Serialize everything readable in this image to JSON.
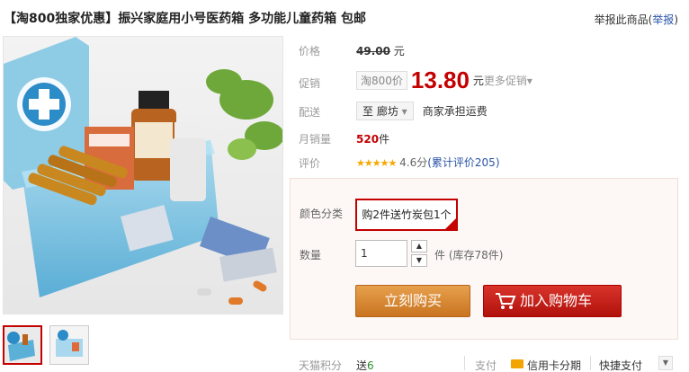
{
  "title": "【淘800独家优惠】振兴家庭用小号医药箱 多功能儿童药箱 包邮",
  "report": {
    "text": "举报此商品",
    "link": "举报"
  },
  "price": {
    "label": "价格",
    "value": "49.00",
    "unit": "元"
  },
  "promo": {
    "label": "促销",
    "tag": "淘800价",
    "value": "13.80",
    "unit": "元",
    "more": "更多促销"
  },
  "shipping": {
    "label": "配送",
    "destination": "至 廊坊",
    "note": "商家承担运费"
  },
  "monthly_sales": {
    "label": "月销量",
    "value": "520",
    "unit": "件"
  },
  "rating": {
    "label": "评价",
    "stars": "★★★★★",
    "score": "4.6分",
    "review_text": "(累计评价205)"
  },
  "options": {
    "color_label": "颜色分类",
    "color_value": "购2件送竹炭包1个",
    "qty_label": "数量",
    "qty_value": "1",
    "stock": "件 (库存78件)"
  },
  "buttons": {
    "buy": "立刻购买",
    "cart": "加入购物车"
  },
  "bottom": {
    "points_label": "天猫积分",
    "points_prefix": "送",
    "points_value": "6",
    "pay_label": "支付",
    "pay1": "信用卡分期",
    "pay2": "快捷支付"
  },
  "colors": {
    "accent": "#c40000",
    "buy": "#d9862c",
    "link": "#2953a6"
  },
  "icons": [
    "cart-icon",
    "credit-card-icon",
    "chevron-down-icon",
    "chevron-up-icon",
    "star-icon"
  ]
}
